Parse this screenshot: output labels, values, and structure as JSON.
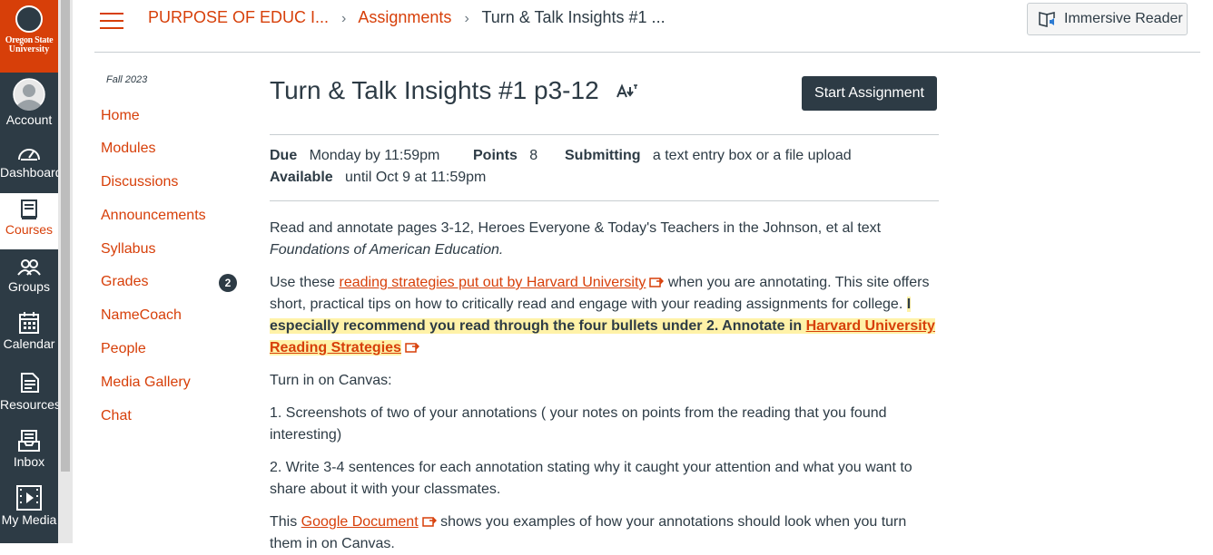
{
  "global_nav": {
    "logo_line1": "Oregon State",
    "logo_line2": "University",
    "items": [
      {
        "label": "Account",
        "icon": "avatar-icon"
      },
      {
        "label": "Dashboard",
        "icon": "dashboard-icon"
      },
      {
        "label": "Courses",
        "icon": "courses-icon"
      },
      {
        "label": "Groups",
        "icon": "groups-icon"
      },
      {
        "label": "Calendar",
        "icon": "calendar-icon"
      },
      {
        "label": "Resources",
        "icon": "resources-icon"
      },
      {
        "label": "Inbox",
        "icon": "inbox-icon"
      },
      {
        "label": "My Media",
        "icon": "media-icon"
      }
    ],
    "active_color": "#d73f09"
  },
  "breadcrumb": {
    "course": "PURPOSE OF EDUC I...",
    "section": "Assignments",
    "current": "Turn & Talk Insights #1 ..."
  },
  "immersive_reader": "Immersive Reader",
  "course_nav": {
    "term": "Fall 2023",
    "items": [
      "Home",
      "Modules",
      "Discussions",
      "Announcements",
      "Syllabus",
      "Grades",
      "NameCoach",
      "People",
      "Media Gallery",
      "Chat"
    ],
    "grades_badge": "2"
  },
  "assignment": {
    "title": "Turn & Talk Insights #1 p3-12",
    "start_button": "Start Assignment",
    "due_label": "Due",
    "due_value": "Monday by 11:59pm",
    "points_label": "Points",
    "points_value": "8",
    "submitting_label": "Submitting",
    "submitting_value": "a text entry box or a file upload",
    "available_label": "Available",
    "available_value": "until Oct 9 at 11:59pm"
  },
  "content": {
    "p1_text": "Read and annotate pages 3-12, Heroes Everyone  & Today's Teachers  in the Johnson, et al text",
    "p1_book": "Foundations of American Education.",
    "p2_pre": "Use these ",
    "p2_link": "reading strategies put out by Harvard University",
    "p2_post": " when you are annotating.  This site offers short, practical tips on how to critically read and engage with your reading assignments for college. ",
    "p2_highlight": "I especially recommend you read through the four bullets under 2.  Annotate in ",
    "p2_highlight_link": "Harvard University Reading Strategies",
    "p3": "Turn in on Canvas:",
    "p4": "1. Screenshots of two of your annotations ( your notes on points from the reading that you found interesting)",
    "p5": "2. Write 3-4 sentences for each annotation stating why it caught your attention and what you want to share about it with your classmates.",
    "p6_pre": "This ",
    "p6_link": "Google Document",
    "p6_post": " shows you examples of how your annotations should look when you turn them in on Canvas."
  }
}
